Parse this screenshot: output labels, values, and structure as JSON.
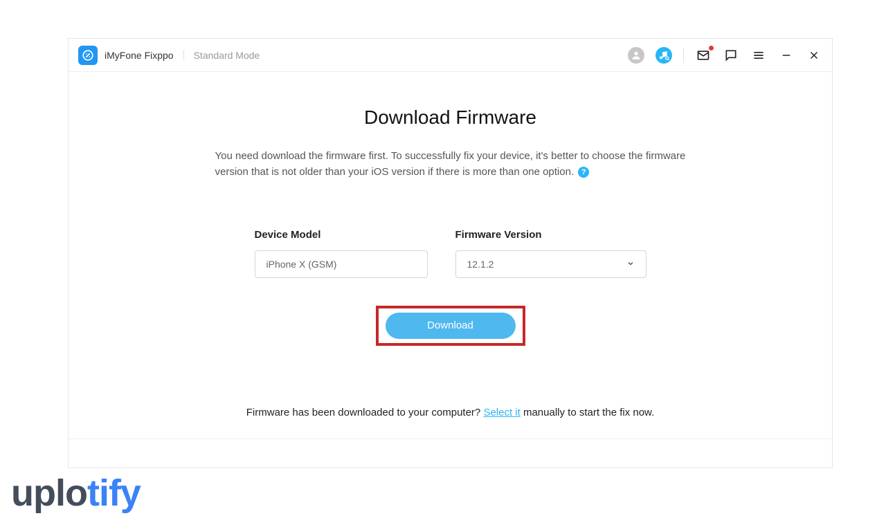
{
  "header": {
    "app_title": "iMyFone Fixppo",
    "mode": "Standard Mode"
  },
  "main": {
    "title": "Download Firmware",
    "description": "You need download the firmware first. To successfully fix your device, it's better to choose the firmware version that is not older than your iOS version if there is more than one option.",
    "help_glyph": "?",
    "device_model_label": "Device Model",
    "device_model_value": "iPhone X (GSM)",
    "firmware_version_label": "Firmware Version",
    "firmware_version_value": "12.1.2",
    "download_label": "Download",
    "footer_prefix": "Firmware has been downloaded to your computer? ",
    "footer_link": "Select it",
    "footer_suffix": " manually to start the fix now."
  },
  "watermark": {
    "part1": "uplo",
    "part2": "tify"
  }
}
